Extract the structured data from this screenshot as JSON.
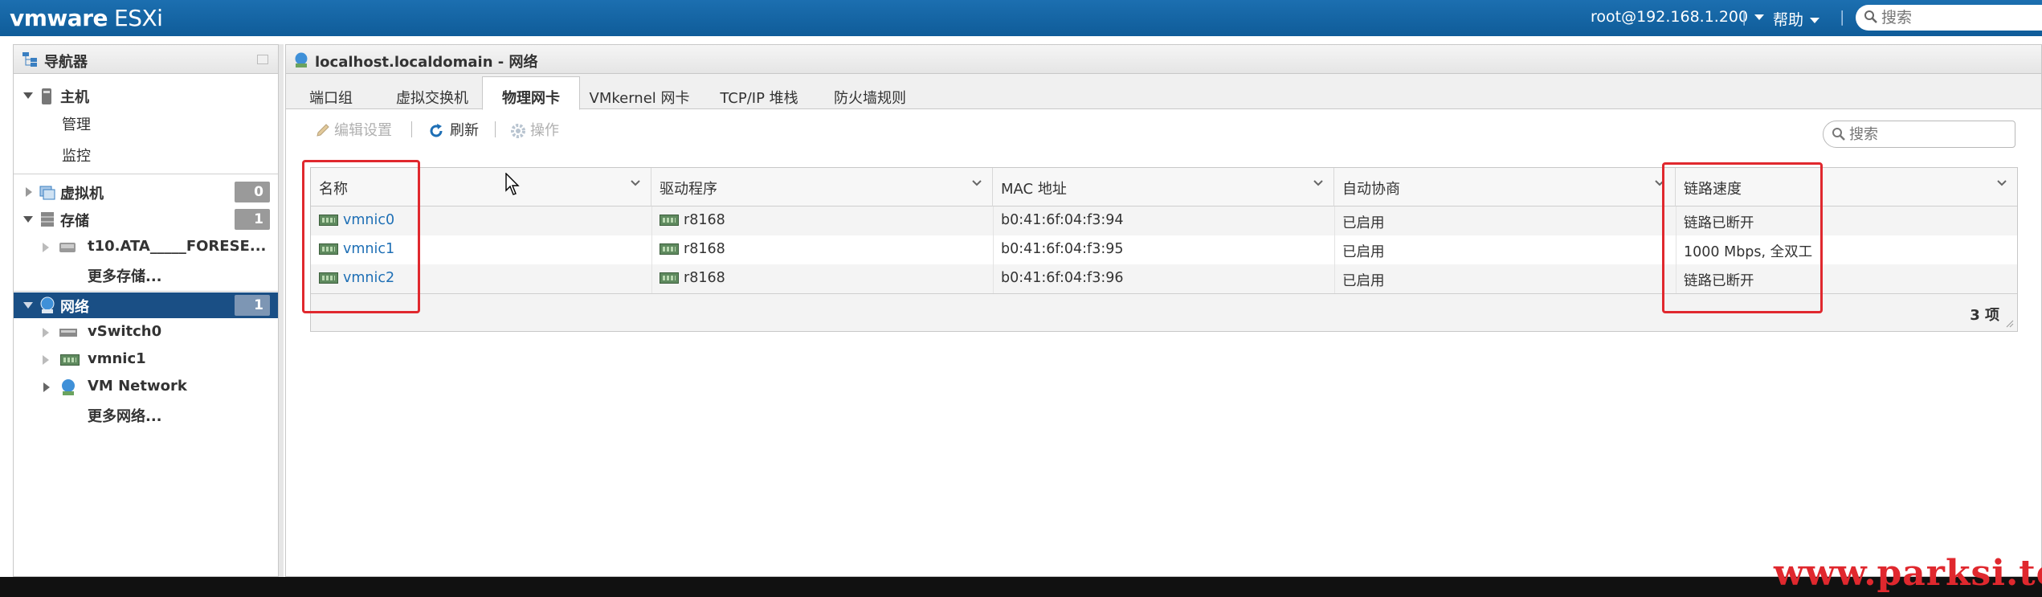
{
  "topbar": {
    "logo_vm": "vmware",
    "logo_product": "ESXi",
    "user": "root@192.168.1.200",
    "help": "帮助",
    "search_placeholder": "搜索"
  },
  "navigator": {
    "title": "导航器",
    "host": {
      "label": "主机",
      "children": [
        "管理",
        "监控"
      ]
    },
    "vms": {
      "label": "虚拟机",
      "count": "0"
    },
    "storage": {
      "label": "存储",
      "count": "1",
      "children": [
        "t10.ATA_____FORESE...",
        "更多存储..."
      ]
    },
    "network": {
      "label": "网络",
      "count": "1",
      "children": [
        "vSwitch0",
        "vmnic1",
        "VM Network",
        "更多网络..."
      ]
    }
  },
  "main": {
    "title": "localhost.localdomain - 网络",
    "tabs": [
      "端口组",
      "虚拟交换机",
      "物理网卡",
      "VMkernel 网卡",
      "TCP/IP 堆栈",
      "防火墙规则"
    ],
    "active_tab": "物理网卡",
    "toolbar": {
      "edit": "编辑设置",
      "refresh": "刷新",
      "actions": "操作",
      "search_placeholder": "搜索"
    },
    "table": {
      "columns": [
        "名称",
        "驱动程序",
        "MAC 地址",
        "自动协商",
        "链路速度"
      ],
      "rows": [
        {
          "name": "vmnic0",
          "driver": "r8168",
          "mac": "b0:41:6f:04:f3:94",
          "auto": "已启用",
          "speed": "链路已断开"
        },
        {
          "name": "vmnic1",
          "driver": "r8168",
          "mac": "b0:41:6f:04:f3:95",
          "auto": "已启用",
          "speed": "1000 Mbps, 全双工"
        },
        {
          "name": "vmnic2",
          "driver": "r8168",
          "mac": "b0:41:6f:04:f3:96",
          "auto": "已启用",
          "speed": "链路已断开"
        }
      ],
      "count": "3 项"
    }
  },
  "watermark": "www.parksi.top",
  "colors": {
    "accent": "#1a4f85",
    "highlight": "#e0282e",
    "link": "#1e6fb5"
  }
}
